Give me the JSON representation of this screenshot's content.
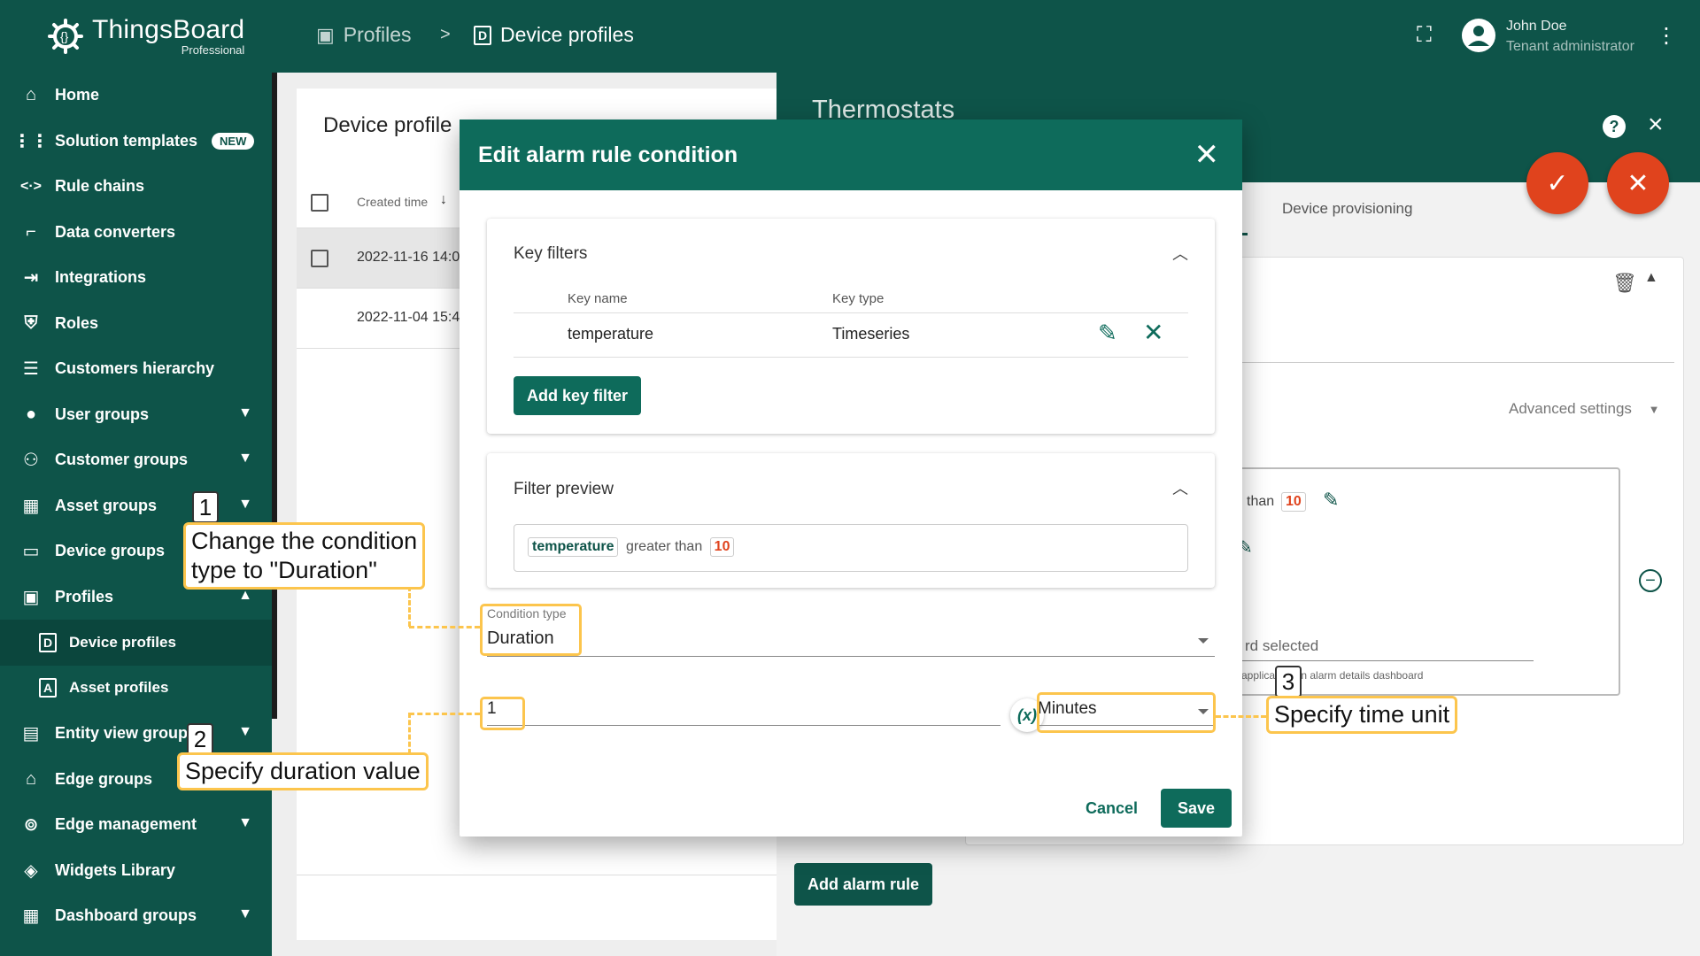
{
  "logo": {
    "name": "ThingsBoard",
    "sub": "Professional"
  },
  "sidebar": {
    "items": [
      {
        "label": "Home",
        "icon": "home-icon",
        "glyph": "⌂"
      },
      {
        "label": "Solution templates",
        "icon": "grid-icon",
        "glyph": "⋮⋮",
        "badge": "NEW"
      },
      {
        "label": "Rule chains",
        "icon": "rule-chain-icon",
        "glyph": "<·>"
      },
      {
        "label": "Data converters",
        "icon": "crop-icon",
        "glyph": "⌐"
      },
      {
        "label": "Integrations",
        "icon": "input-icon",
        "glyph": "⇥"
      },
      {
        "label": "Roles",
        "icon": "shield-icon",
        "glyph": "⛨"
      },
      {
        "label": "Customers hierarchy",
        "icon": "sort-icon",
        "glyph": "☰"
      },
      {
        "label": "User groups",
        "icon": "account-icon",
        "glyph": "●"
      },
      {
        "label": "Customer groups",
        "icon": "people-icon",
        "glyph": "⚇"
      },
      {
        "label": "Asset groups",
        "icon": "domain-icon",
        "glyph": "▦"
      },
      {
        "label": "Device groups",
        "icon": "devices-icon",
        "glyph": "▭"
      },
      {
        "label": "Profiles",
        "icon": "badge-icon",
        "glyph": "▣"
      },
      {
        "label": "Device profiles",
        "icon": "device-profile-icon",
        "glyph": "D"
      },
      {
        "label": "Asset profiles",
        "icon": "asset-profile-icon",
        "glyph": "A"
      },
      {
        "label": "Entity view groups",
        "icon": "view-quilt-icon",
        "glyph": "▤"
      },
      {
        "label": "Edge groups",
        "icon": "router-icon",
        "glyph": "⌂"
      },
      {
        "label": "Edge management",
        "icon": "settings-input-antenna-icon",
        "glyph": "⊚"
      },
      {
        "label": "Widgets Library",
        "icon": "widgets-icon",
        "glyph": "◈"
      },
      {
        "label": "Dashboard groups",
        "icon": "dashboard-icon",
        "glyph": "▦"
      }
    ]
  },
  "topbar": {
    "crumb1": "Profiles",
    "crumb_sep": ">",
    "crumb2": "Device profiles",
    "user_name": "John Doe",
    "user_role": "Tenant administrator"
  },
  "bg_table": {
    "title": "Device profile",
    "col_created": "Created time",
    "rows": [
      "2022-11-16 14:0",
      "2022-11-04 15:4"
    ]
  },
  "details": {
    "title": "Thermostats",
    "tab_provisioning": "Device provisioning",
    "advanced": "Advanced settings",
    "than": "than",
    "than_value": "10",
    "no_dashboard": "rd selected",
    "hint": "applica    s an alarm details dashboard",
    "add_alarm_rule": "Add alarm rule"
  },
  "dialog": {
    "title": "Edit alarm rule condition",
    "key_filters": {
      "title": "Key filters",
      "col_name": "Key name",
      "col_type": "Key type",
      "row_name": "temperature",
      "row_type": "Timeseries",
      "add_button": "Add key filter"
    },
    "filter_preview": {
      "title": "Filter preview",
      "key": "temperature",
      "op": "greater than",
      "value": "10"
    },
    "condition_type": {
      "label": "Condition type",
      "value": "Duration"
    },
    "duration_value": "1",
    "variable_button": "(x)",
    "time_unit": "Minutes",
    "cancel": "Cancel",
    "save": "Save"
  },
  "annotations": {
    "n1": "1",
    "c1_line1": "Change the condition",
    "c1_line2": "type to \"Duration\"",
    "n2": "2",
    "c2": "Specify duration value",
    "n3": "3",
    "c3": "Specify time unit"
  },
  "colors": {
    "brand": "#0e5449",
    "accent": "#e0431d",
    "highlight": "#fcc54d"
  }
}
